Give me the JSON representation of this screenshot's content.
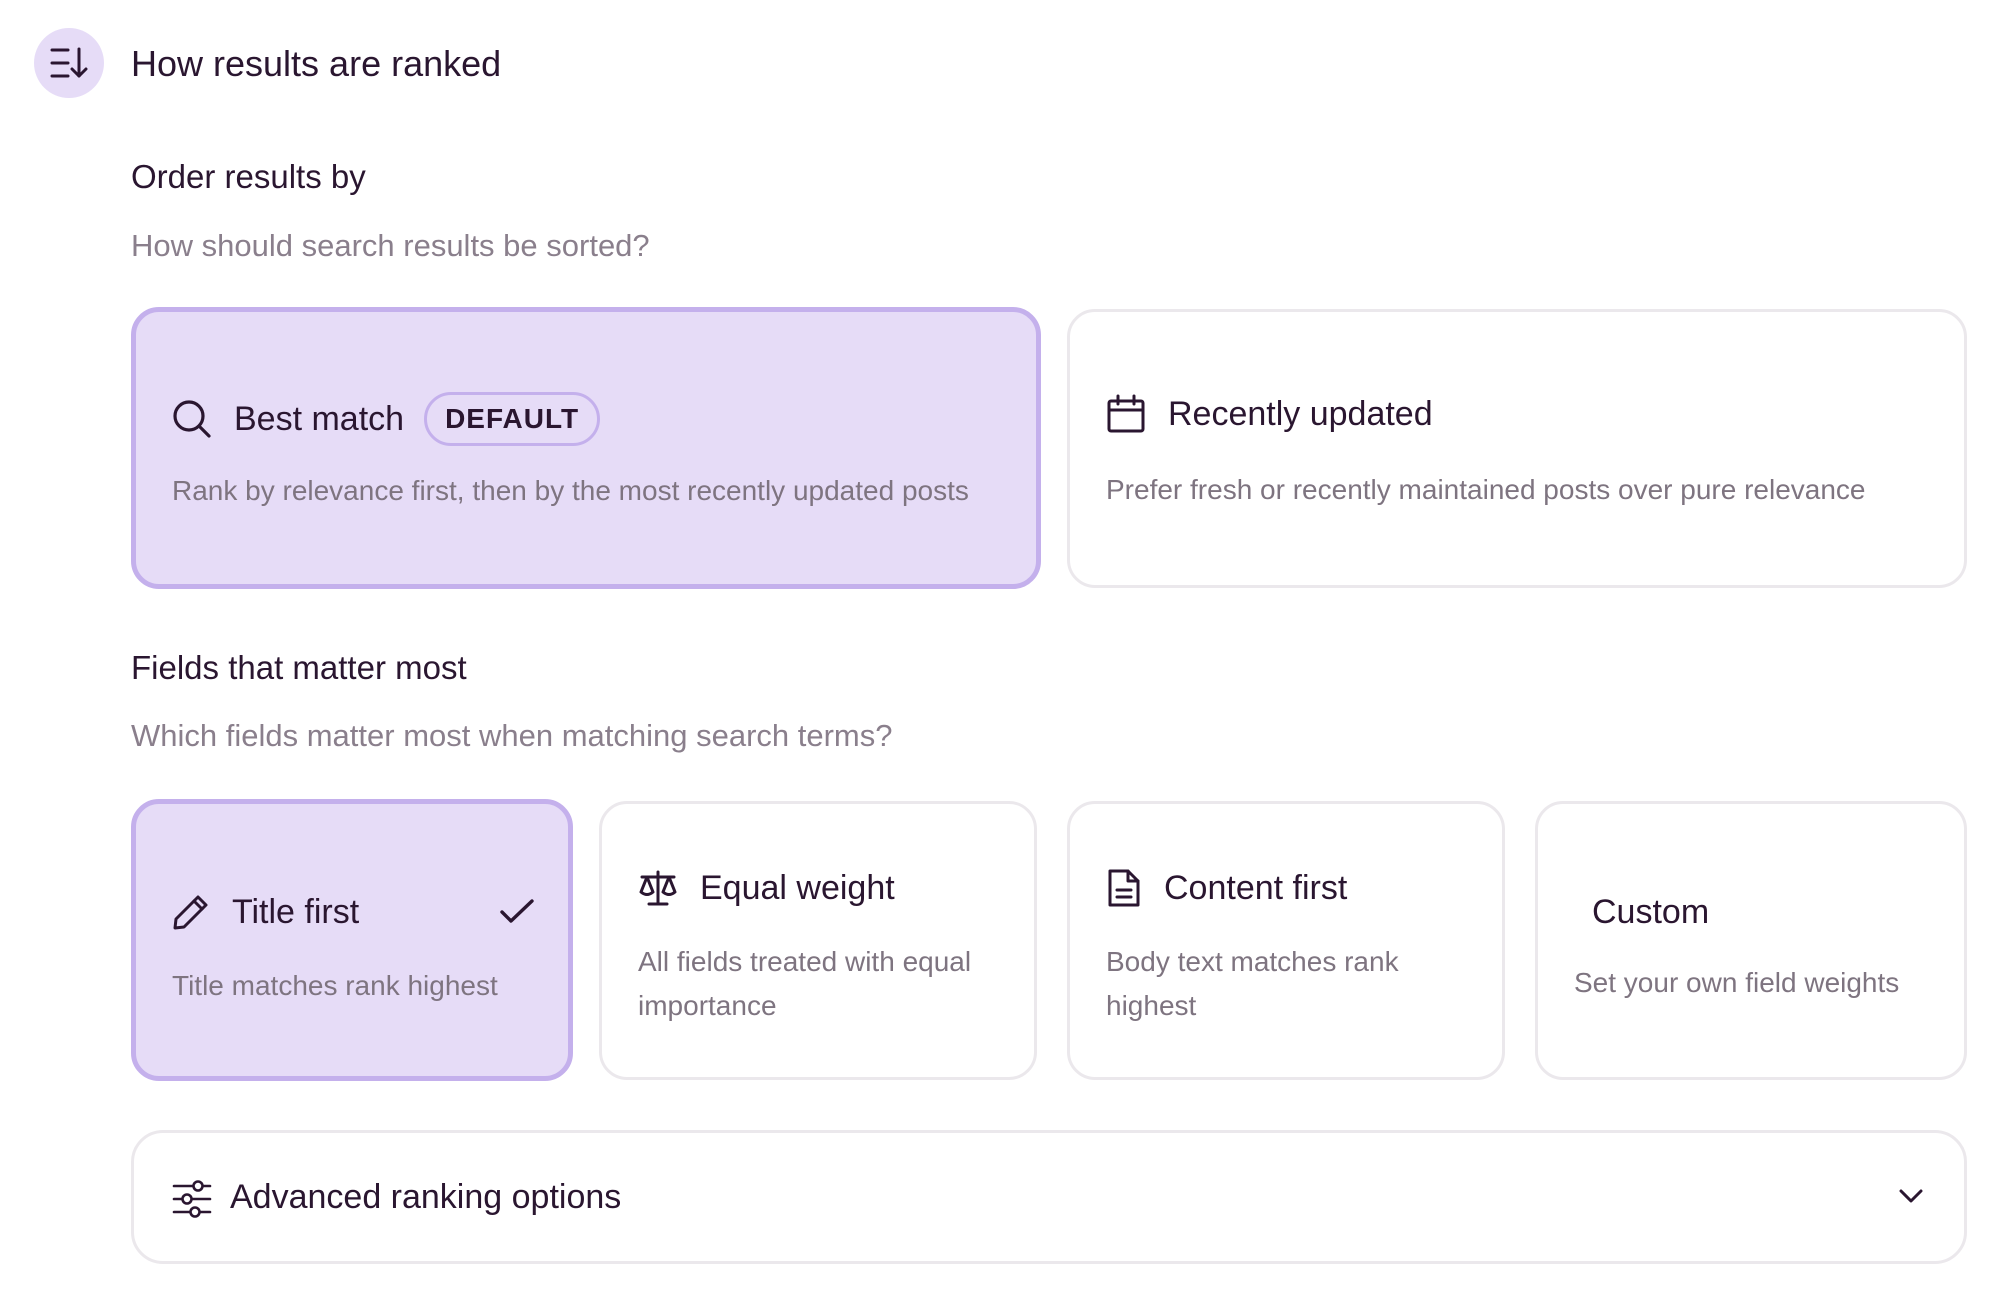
{
  "section": {
    "title": "How results are ranked",
    "icon": "sort-descending-icon"
  },
  "order": {
    "label": "Order results by",
    "help": "How should search results be sorted?",
    "options": [
      {
        "id": "best-match",
        "title": "Best match",
        "badge": "DEFAULT",
        "description": "Rank by relevance first, then by the most recently updated posts",
        "icon": "search-icon",
        "selected": true
      },
      {
        "id": "recently-updated",
        "title": "Recently updated",
        "description": "Prefer fresh or recently maintained posts over pure relevance",
        "icon": "calendar-icon",
        "selected": false
      }
    ]
  },
  "fields": {
    "label": "Fields that matter most",
    "help": "Which fields matter most when matching search terms?",
    "options": [
      {
        "id": "title-first",
        "title": "Title first",
        "description": "Title matches rank highest",
        "icon": "pencil-icon",
        "selected": true
      },
      {
        "id": "equal-weight",
        "title": "Equal weight",
        "description_line1": "All fields treated with equal",
        "description_line2": "importance",
        "icon": "scale-icon",
        "selected": false
      },
      {
        "id": "content-first",
        "title": "Content first",
        "description_line1": "Body text matches rank",
        "description_line2": "highest",
        "icon": "document-icon",
        "selected": false
      },
      {
        "id": "custom",
        "title": "Custom",
        "description": "Set your own field weights",
        "selected": false
      }
    ]
  },
  "advanced": {
    "label": "Advanced ranking options",
    "icon": "sliders-icon",
    "expanded": false
  },
  "colors": {
    "accent_bg": "#e6dcf7",
    "accent_border": "#c4b0ec",
    "text_primary": "#2a1630",
    "text_secondary": "#7e7480",
    "card_border": "#ebe8ec"
  }
}
